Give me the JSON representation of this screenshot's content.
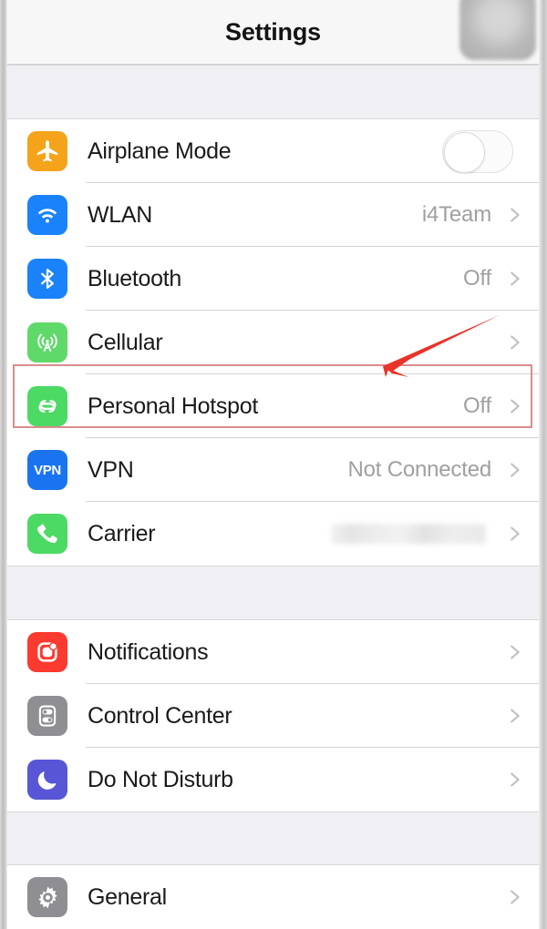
{
  "navbar": {
    "title": "Settings",
    "redaction_name": "blurred-avatar"
  },
  "groups": [
    {
      "name": "connectivity",
      "rows": [
        {
          "label": "Airplane Mode",
          "value": "",
          "icon": "airplane-icon",
          "icon_color": "#f5a31a",
          "accessory": "toggle",
          "toggle_on": false
        },
        {
          "label": "WLAN",
          "value": "i4Team",
          "icon": "wifi-icon",
          "icon_color": "#1a82fb",
          "accessory": "chevron"
        },
        {
          "label": "Bluetooth",
          "value": "Off",
          "icon": "bluetooth-icon",
          "icon_color": "#1a82fb",
          "accessory": "chevron"
        },
        {
          "label": "Cellular",
          "value": "",
          "icon": "cellular-antenna-icon",
          "icon_color": "#5fd96a",
          "accessory": "chevron"
        },
        {
          "label": "Personal Hotspot",
          "value": "Off",
          "icon": "hotspot-link-icon",
          "icon_color": "#4cd964",
          "accessory": "chevron",
          "highlighted": true
        },
        {
          "label": "VPN",
          "value": "Not Connected",
          "icon": "vpn-icon",
          "icon_color": "#1a74f0",
          "accessory": "chevron"
        },
        {
          "label": "Carrier",
          "value": "",
          "icon": "phone-icon",
          "icon_color": "#4cd964",
          "accessory": "chevron",
          "value_redacted": true
        }
      ]
    },
    {
      "name": "system",
      "rows": [
        {
          "label": "Notifications",
          "value": "",
          "icon": "notifications-icon",
          "icon_color": "#fb3b30",
          "accessory": "chevron"
        },
        {
          "label": "Control Center",
          "value": "",
          "icon": "control-center-icon",
          "icon_color": "#8e8e93",
          "accessory": "chevron"
        },
        {
          "label": "Do Not Disturb",
          "value": "",
          "icon": "moon-icon",
          "icon_color": "#5856d6",
          "accessory": "chevron"
        }
      ]
    },
    {
      "name": "general",
      "rows": [
        {
          "label": "General",
          "value": "",
          "icon": "gear-icon",
          "icon_color": "#8e8e93",
          "accessory": "chevron"
        }
      ]
    }
  ],
  "annotations": {
    "highlight_color": "#d98d8d",
    "arrow_color": "#e8342a",
    "highlight_target": "Personal Hotspot",
    "arrow_target": "Personal Hotspot"
  },
  "icon_labels": {
    "vpn": "VPN"
  }
}
